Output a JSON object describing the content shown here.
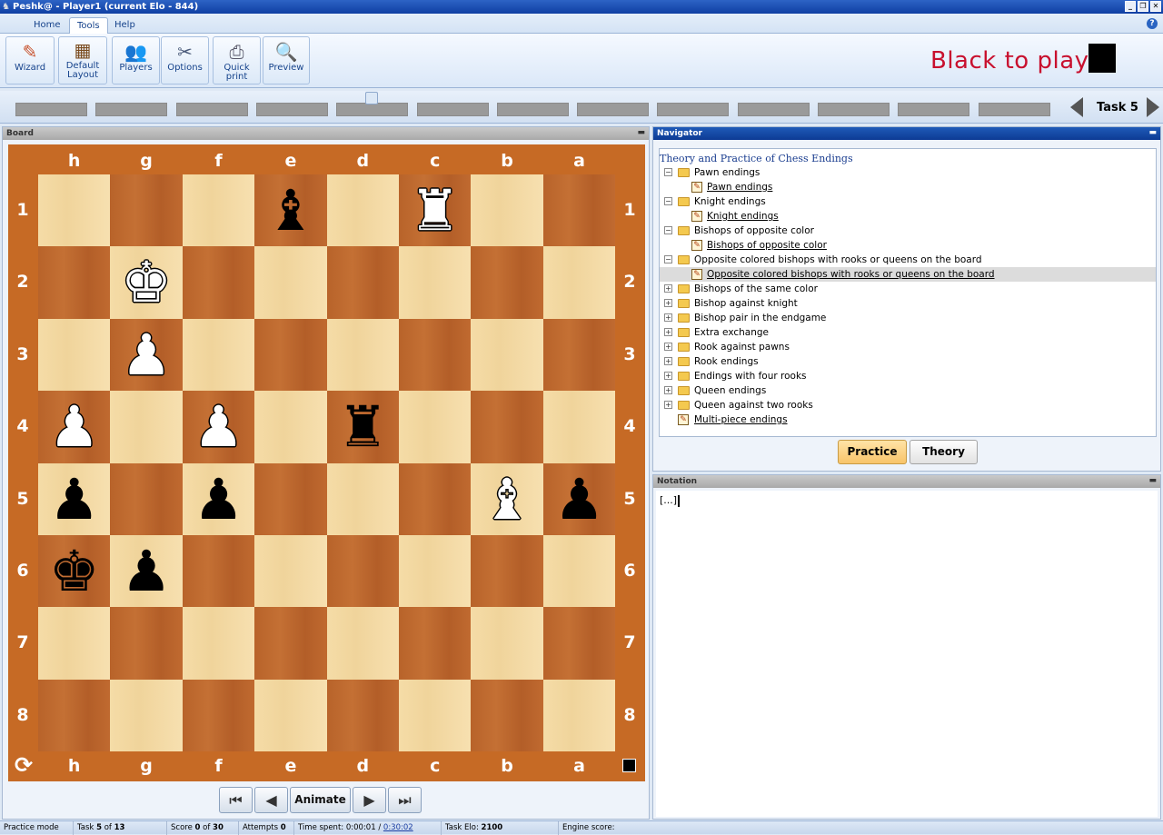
{
  "window": {
    "title": "Peshk@ - Player1 (current Elo - 844)"
  },
  "ribbon_tabs": [
    "Home",
    "Tools",
    "Help"
  ],
  "active_tab": "Tools",
  "toolbar": {
    "wizard": "Wizard",
    "default_layout_line1": "Default",
    "default_layout_line2": "Layout",
    "players": "Players",
    "options": "Options",
    "quick_print": "Quick print",
    "preview": "Preview"
  },
  "turn_indicator": "Black to play",
  "task": {
    "label": "Task 5",
    "progress_segments": 13,
    "current_segment": 5
  },
  "board_panel": {
    "title": "Board",
    "files": [
      "h",
      "g",
      "f",
      "e",
      "d",
      "c",
      "b",
      "a"
    ],
    "ranks": [
      "1",
      "2",
      "3",
      "4",
      "5",
      "6",
      "7",
      "8"
    ],
    "pieces": [
      {
        "square": "e1",
        "color": "black",
        "type": "bishop",
        "glyph": "♝"
      },
      {
        "square": "c1",
        "color": "white",
        "type": "rook",
        "glyph": "♜"
      },
      {
        "square": "g2",
        "color": "white",
        "type": "king",
        "glyph": "♚"
      },
      {
        "square": "g3",
        "color": "white",
        "type": "pawn",
        "glyph": "♟"
      },
      {
        "square": "h4",
        "color": "white",
        "type": "pawn",
        "glyph": "♟"
      },
      {
        "square": "f4",
        "color": "white",
        "type": "pawn",
        "glyph": "♟"
      },
      {
        "square": "d4",
        "color": "black",
        "type": "rook",
        "glyph": "♜"
      },
      {
        "square": "h5",
        "color": "black",
        "type": "pawn",
        "glyph": "♟"
      },
      {
        "square": "f5",
        "color": "black",
        "type": "pawn",
        "glyph": "♟"
      },
      {
        "square": "b5",
        "color": "white",
        "type": "bishop",
        "glyph": "♝"
      },
      {
        "square": "a5",
        "color": "black",
        "type": "pawn",
        "glyph": "♟"
      },
      {
        "square": "h6",
        "color": "black",
        "type": "king",
        "glyph": "♚"
      },
      {
        "square": "g6",
        "color": "black",
        "type": "pawn",
        "glyph": "♟"
      }
    ],
    "nav_buttons": {
      "first": "⏮",
      "prev": "◀",
      "animate": "Animate",
      "next": "▶",
      "last": "⏭"
    }
  },
  "navigator": {
    "title": "Navigator",
    "tree_title": "Theory and Practice of Chess Endings",
    "tree": [
      {
        "label": "Pawn endings",
        "kind": "folder",
        "expanded": true
      },
      {
        "label": "Pawn endings",
        "kind": "leaf"
      },
      {
        "label": "Knight endings",
        "kind": "folder",
        "expanded": true
      },
      {
        "label": "Knight endings",
        "kind": "leaf"
      },
      {
        "label": "Bishops of opposite color",
        "kind": "folder",
        "expanded": true
      },
      {
        "label": "Bishops of opposite color",
        "kind": "leaf"
      },
      {
        "label": "Opposite colored bishops with rooks or queens on the board",
        "kind": "folder",
        "expanded": true
      },
      {
        "label": "Opposite colored bishops with rooks or queens on the board",
        "kind": "leaf",
        "selected": true
      },
      {
        "label": "Bishops of the same color",
        "kind": "folder",
        "expanded": false
      },
      {
        "label": "Bishop against knight",
        "kind": "folder",
        "expanded": false
      },
      {
        "label": "Bishop pair in the endgame",
        "kind": "folder",
        "expanded": false
      },
      {
        "label": "Extra exchange",
        "kind": "folder",
        "expanded": false
      },
      {
        "label": "Rook against pawns",
        "kind": "folder",
        "expanded": false
      },
      {
        "label": "Rook endings",
        "kind": "folder",
        "expanded": false
      },
      {
        "label": "Endings with four rooks",
        "kind": "folder",
        "expanded": false
      },
      {
        "label": "Queen endings",
        "kind": "folder",
        "expanded": false
      },
      {
        "label": "Queen against two rooks",
        "kind": "folder",
        "expanded": false
      },
      {
        "label": "Multi-piece endings",
        "kind": "rootleaf"
      }
    ],
    "practice": "Practice",
    "theory": "Theory"
  },
  "notation": {
    "title": "Notation",
    "content": "[...]"
  },
  "status": {
    "mode": "Practice mode",
    "task_prefix": "Task",
    "task_current": "5",
    "task_of": "of",
    "task_total": "13",
    "score_prefix": "Score",
    "score_value": "0",
    "score_of": "of",
    "score_total": "30",
    "attempts_prefix": "Attempts",
    "attempts_value": "0",
    "time_prefix": "Time spent:",
    "time_value": "0:00:01 /",
    "time_limit": "0:30:02",
    "elo_prefix": "Task Elo:",
    "elo_value": "2100",
    "engine_score": "Engine score:"
  },
  "colors": {
    "turn_text": "#c8102e",
    "light_square": "#f0d49b",
    "dark_square": "#c47034",
    "board_frame": "#c66a25"
  }
}
